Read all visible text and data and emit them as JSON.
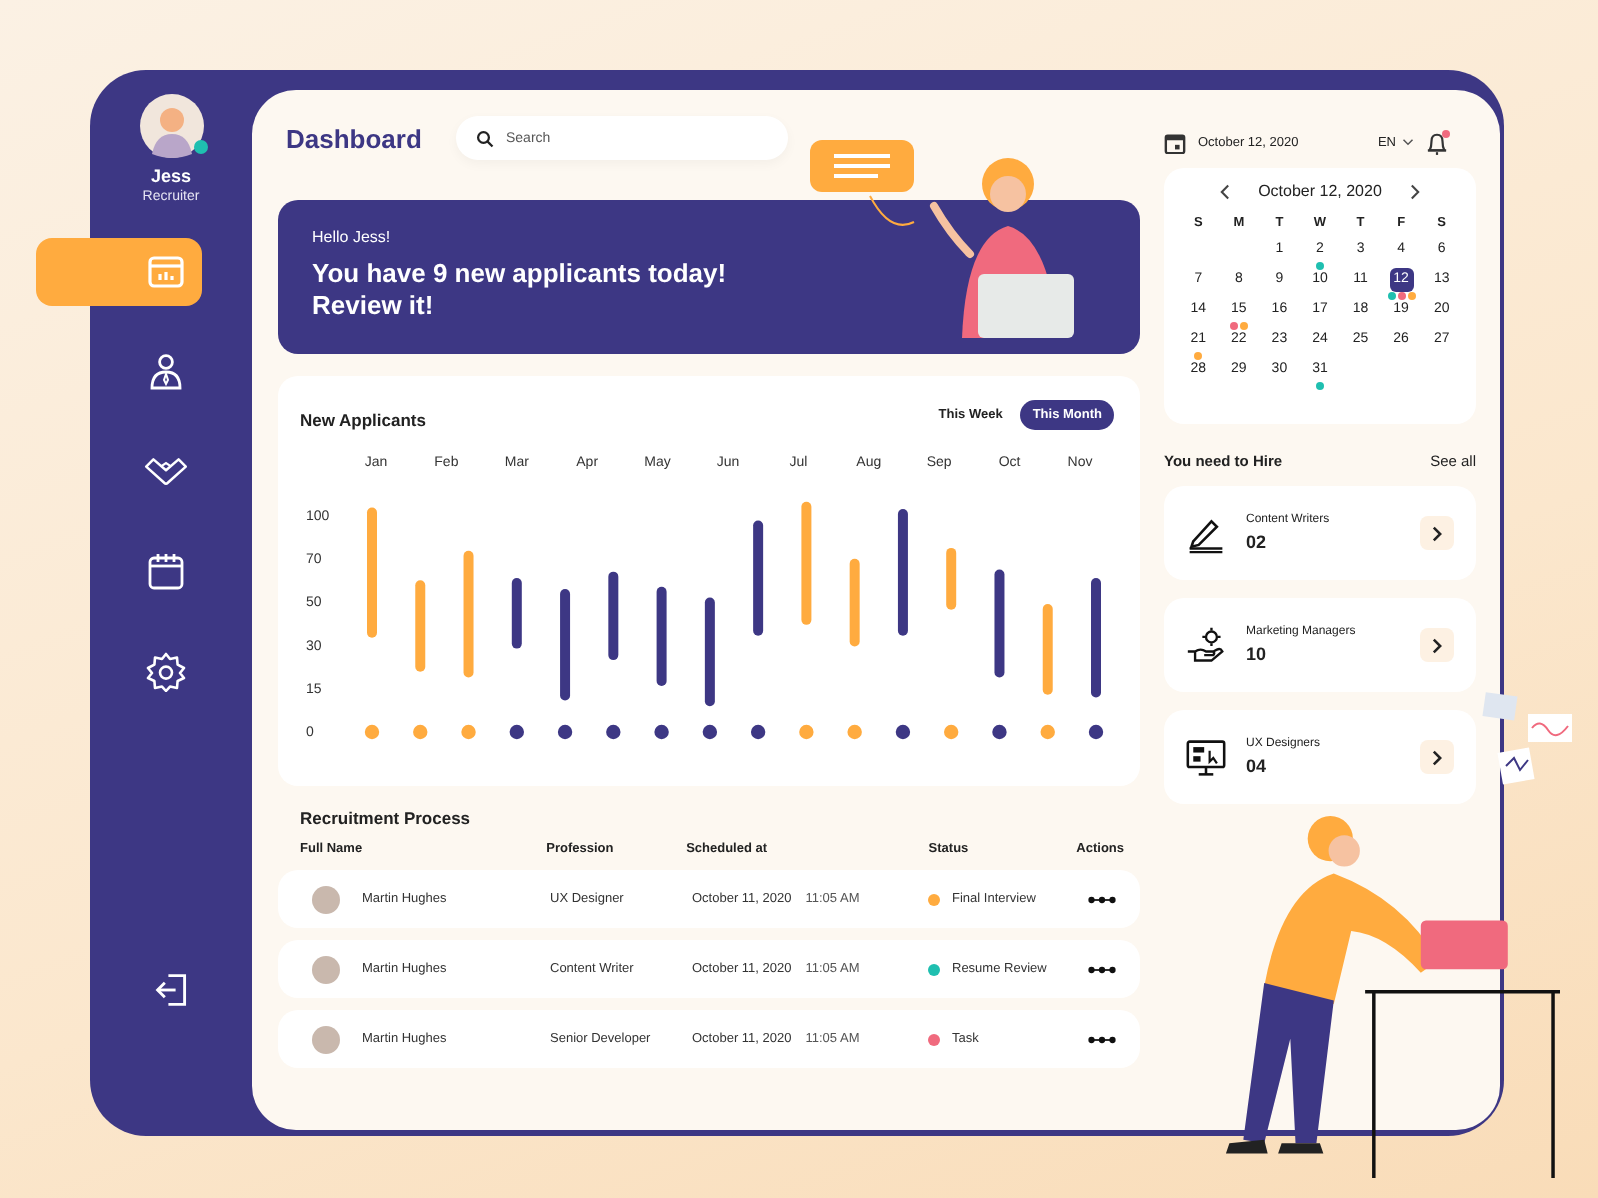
{
  "sidebar": {
    "user": {
      "name": "Jess",
      "role": "Recruiter",
      "online": true
    },
    "nav": [
      {
        "selected": true
      },
      {
        "selected": false
      },
      {
        "selected": false
      },
      {
        "selected": false
      },
      {
        "selected": false
      }
    ]
  },
  "header": {
    "title": "Dashboard",
    "search": {
      "placeholder": "Search"
    },
    "date": "October 12, 2020",
    "language": "EN",
    "has_notification": true
  },
  "banner": {
    "greeting": "Hello Jess!",
    "message_lines": [
      "You have 9 new applicants today!",
      "Review it!"
    ]
  },
  "applicants_chart": {
    "title": "New Applicants",
    "tabs": [
      {
        "label": "This Week",
        "selected": false
      },
      {
        "label": "This Month",
        "selected": true
      }
    ],
    "months": [
      "Jan",
      "Feb",
      "Mar",
      "Apr",
      "May",
      "Jun",
      "Jul",
      "Aug",
      "Sep",
      "Oct",
      "Nov"
    ],
    "y_labels": [
      "100",
      "70",
      "50",
      "30",
      "15",
      "0"
    ]
  },
  "recruitment": {
    "title": "Recruitment Process",
    "columns": [
      "Full Name",
      "Profession",
      "Scheduled at",
      "Status",
      "Actions"
    ],
    "rows": [
      {
        "name": "Martin Hughes",
        "profession": "UX Designer",
        "date": "October 11, 2020",
        "time": "11:05 AM",
        "status": "Final Interview",
        "color": "#ffab3f"
      },
      {
        "name": "Martin Hughes",
        "profession": "Content Writer",
        "date": "October 11, 2020",
        "time": "11:05 AM",
        "status": "Resume Review",
        "color": "#1fbfb0"
      },
      {
        "name": "Martin Hughes",
        "profession": "Senior Developer",
        "date": "October 11, 2020",
        "time": "11:05 AM",
        "status": "Task",
        "color": "#f06a7e"
      }
    ]
  },
  "calendar": {
    "title": "October 12, 2020",
    "weekdays": [
      "S",
      "M",
      "T",
      "W",
      "T",
      "F",
      "S"
    ],
    "weeks": [
      [
        {
          "day": "1",
          "selected": false
        },
        {
          "day": "2",
          "selected": false,
          "dots": [
            {
              "color": "#1fbfb0"
            }
          ]
        },
        {
          "day": "3",
          "selected": false
        },
        {
          "day": "4",
          "selected": false
        },
        {
          "day": "6",
          "selected": false
        }
      ],
      [
        {
          "day": "7",
          "selected": false
        },
        {
          "day": "8",
          "selected": false
        },
        {
          "day": "9",
          "selected": false
        },
        {
          "day": "10",
          "selected": false
        },
        {
          "day": "11",
          "selected": false
        },
        {
          "day": "12",
          "selected": true,
          "dots": [
            {
              "color": "#1fbfb0"
            },
            {
              "color": "#f06a7e"
            },
            {
              "color": "#ffab3f"
            }
          ]
        },
        {
          "day": "13",
          "selected": false
        }
      ],
      [
        {
          "day": "14",
          "selected": false
        },
        {
          "day": "15",
          "selected": false,
          "dots": [
            {
              "color": "#f06a7e"
            },
            {
              "color": "#ffab3f"
            }
          ]
        },
        {
          "day": "16",
          "selected": false
        },
        {
          "day": "17",
          "selected": false
        },
        {
          "day": "18",
          "selected": false
        },
        {
          "day": "19",
          "selected": false
        },
        {
          "day": "20",
          "selected": false
        }
      ],
      [
        {
          "day": "21",
          "selected": false,
          "dots": [
            {
              "color": "#ffab3f"
            }
          ]
        },
        {
          "day": "22",
          "selected": false
        },
        {
          "day": "23",
          "selected": false
        },
        {
          "day": "24",
          "selected": false
        },
        {
          "day": "25",
          "selected": false
        },
        {
          "day": "26",
          "selected": false
        },
        {
          "day": "27",
          "selected": false
        }
      ],
      [
        {
          "day": "28",
          "selected": false
        },
        {
          "day": "29",
          "selected": false
        },
        {
          "day": "30",
          "selected": false
        },
        {
          "day": "31",
          "selected": false,
          "dots": [
            {
              "color": "#1fbfb0"
            }
          ]
        }
      ]
    ]
  },
  "hiring": {
    "title": "You need to Hire",
    "see_all": "See all",
    "items": [
      {
        "role": "Content Writers",
        "count": "02"
      },
      {
        "role": "Marketing Managers",
        "count": "10"
      },
      {
        "role": "UX Designers",
        "count": "04"
      }
    ]
  }
}
